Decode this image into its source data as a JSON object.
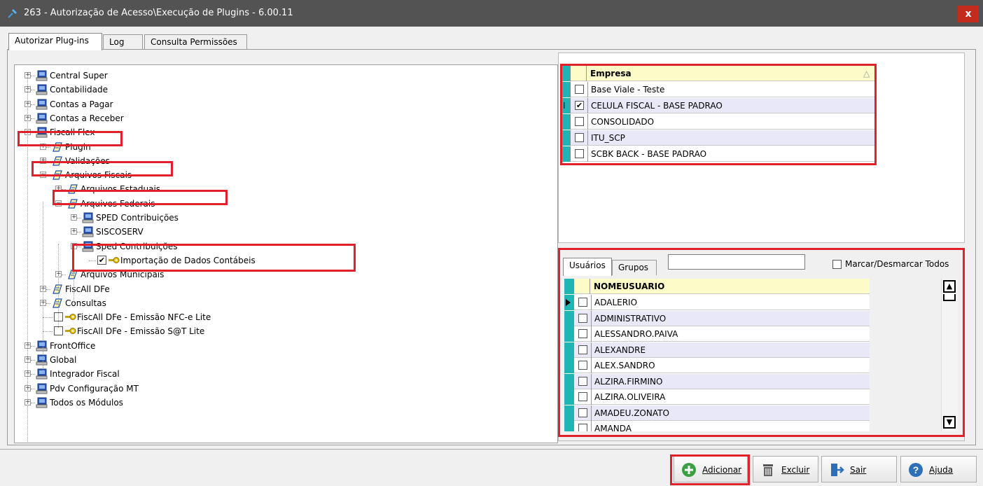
{
  "window": {
    "title": "263 - Autorização de Acesso\\Execução de Plugins - 6.00.11",
    "close": "x"
  },
  "tabs": [
    {
      "label": "Autorizar Plug-ins"
    },
    {
      "label": "Log"
    },
    {
      "label": "Consulta Permissões"
    }
  ],
  "tree": [
    {
      "label": "Central Super"
    },
    {
      "label": "Contabilidade"
    },
    {
      "label": "Contas a Pagar"
    },
    {
      "label": "Contas a Receber"
    },
    {
      "label": "Fiscall Flex"
    },
    {
      "label": "Plugin"
    },
    {
      "label": "Validações"
    },
    {
      "label": "Arquivos Fiscais"
    },
    {
      "label": "Arquivos Estaduais"
    },
    {
      "label": "Arquivos Federais"
    },
    {
      "label": "SPED Contribuições"
    },
    {
      "label": "SISCOSERV"
    },
    {
      "label": "Sped Contribuições"
    },
    {
      "label": "Importação de Dados Contábeis"
    },
    {
      "label": "Arquivos Municipais"
    },
    {
      "label": "FiscAll DFe"
    },
    {
      "label": "Consultas"
    },
    {
      "label": "FiscAll DFe - Emissão NFC-e Lite"
    },
    {
      "label": "FiscAll DFe - Emissão S@T Lite"
    },
    {
      "label": "FrontOffice"
    },
    {
      "label": "Global"
    },
    {
      "label": "Integrador Fiscal"
    },
    {
      "label": "Pdv Configuração MT"
    },
    {
      "label": "Todos os Módulos"
    }
  ],
  "empresa": {
    "header": "Empresa",
    "sort_glyph": "△",
    "rows": [
      {
        "name": "Base Viale - Teste",
        "checked": false
      },
      {
        "name": "CELULA FISCAL - BASE PADRAO",
        "checked": true
      },
      {
        "name": "CONSOLIDADO",
        "checked": false
      },
      {
        "name": "ITU_SCP",
        "checked": false
      },
      {
        "name": "SCBK BACK - BASE PADRAO",
        "checked": false
      }
    ]
  },
  "users": {
    "tabs": [
      {
        "label": "Usuários"
      },
      {
        "label": "Grupos"
      }
    ],
    "search_value": "",
    "mark_all": "Marcar/Desmarcar Todos",
    "header": "NOMEUSUARIO",
    "rows": [
      "ADALERIO",
      "ADMINISTRATIVO",
      "ALESSANDRO.PAIVA",
      "ALEXANDRE",
      "ALEX.SANDRO",
      "ALZIRA.FIRMINO",
      "ALZIRA.OLIVEIRA",
      "AMADEU.ZONATO",
      "AMANDA"
    ]
  },
  "buttons": {
    "add": "Adicionar",
    "delete": "Excluir",
    "exit": "Sair",
    "help": "Ajuda"
  },
  "colors": {
    "highlight": "#e0202a",
    "indicator": "#1fb5b5",
    "title_bg": "#535353"
  }
}
